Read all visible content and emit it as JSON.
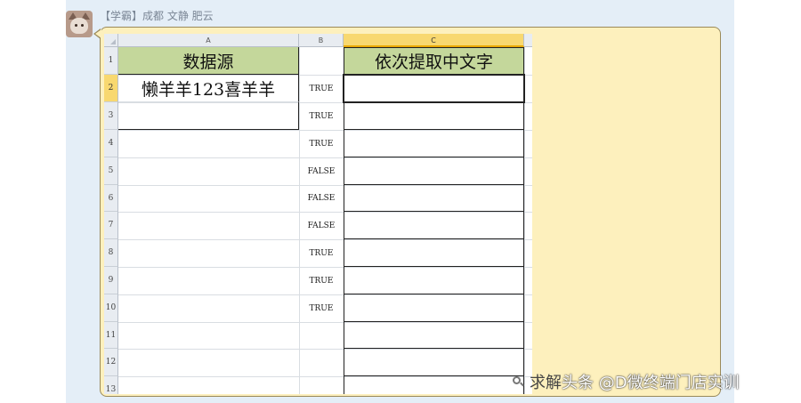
{
  "chat": {
    "sender": "【学霸】成都 文静 肥云"
  },
  "sheet": {
    "columns": [
      "A",
      "B",
      "C"
    ],
    "row_numbers": [
      "1",
      "2",
      "3",
      "4",
      "5",
      "6",
      "7",
      "8",
      "9",
      "10",
      "11",
      "12",
      "13"
    ],
    "a1": "数据源",
    "c1": "依次提取中文字",
    "a2": "懒羊羊123喜羊羊",
    "b_values": [
      "TRUE",
      "TRUE",
      "TRUE",
      "FALSE",
      "FALSE",
      "FALSE",
      "TRUE",
      "TRUE",
      "TRUE"
    ],
    "selected_column": "C",
    "selected_row": "2",
    "header_fill_color": "#c4d79b"
  },
  "watermark": {
    "hidden_text": "求解",
    "text": "头条 @D微终端门店实训",
    "icon": "zoom-icon"
  }
}
